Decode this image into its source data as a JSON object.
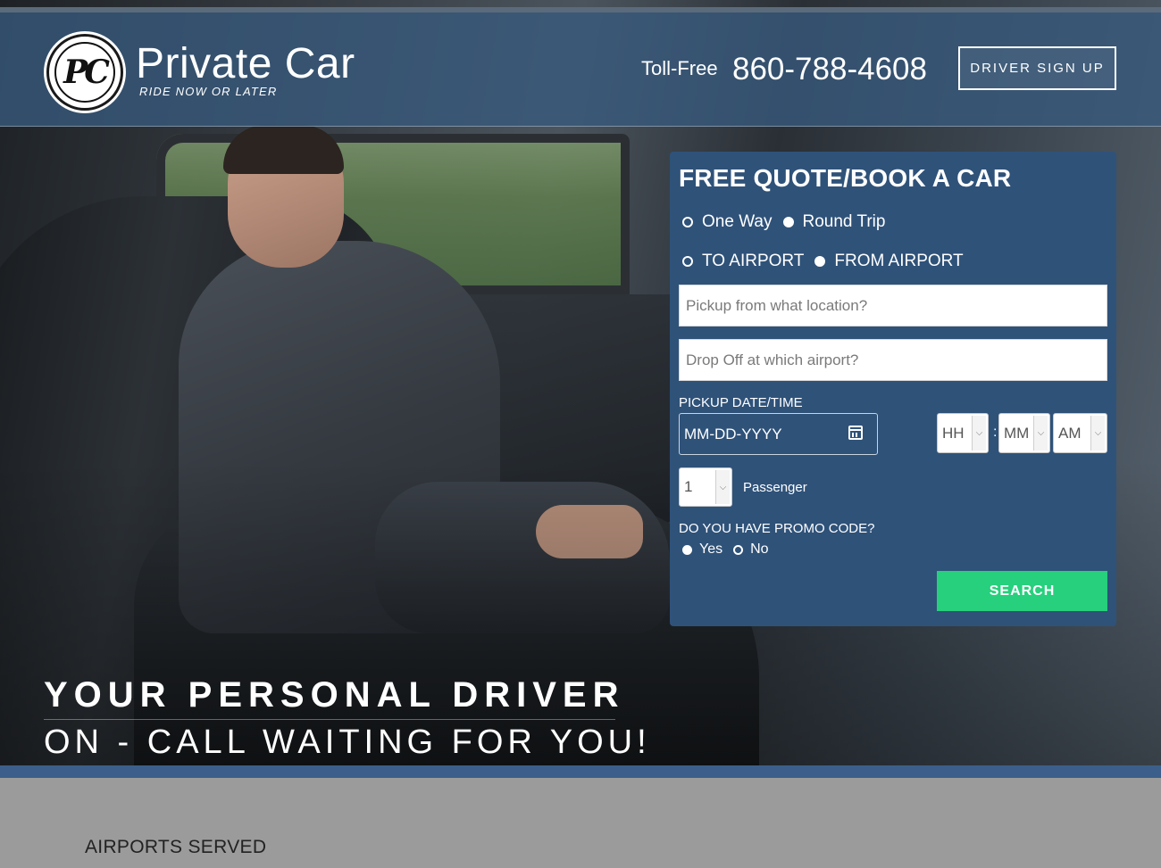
{
  "header": {
    "brand_name": "Private Car",
    "brand_tagline": "RIDE NOW OR LATER",
    "logo_mark": "PC",
    "phone_label": "Toll-Free",
    "phone_number": "860-788-4608",
    "driver_signup": "DRIVER SIGN UP"
  },
  "booking": {
    "title": "FREE QUOTE/BOOK A CAR",
    "trip_type": {
      "options": [
        "One Way",
        "Round Trip"
      ],
      "selected": "Round Trip"
    },
    "direction": {
      "options": [
        "TO AIRPORT",
        "FROM AIRPORT"
      ],
      "selected": "FROM AIRPORT"
    },
    "pickup_placeholder": "Pickup from what location?",
    "dropoff_placeholder": "Drop Off at which airport?",
    "datetime_label": "PICKUP DATE/TIME",
    "date_placeholder": "MM-DD-YYYY",
    "hour": "HH",
    "minute": "MM",
    "ampm": "AM",
    "passengers": "1",
    "passenger_label": "Passenger",
    "promo_question": "DO YOU HAVE PROMO CODE?",
    "promo": {
      "options": [
        "Yes",
        "No"
      ],
      "selected": "Yes"
    },
    "search_label": "SEARCH"
  },
  "hero": {
    "tagline_1": "YOUR PERSONAL DRIVER",
    "tagline_2": "ON - CALL WAITING FOR YOU!"
  },
  "sections": {
    "airports_heading": "AIRPORTS SERVED"
  },
  "colors": {
    "header_bg": "#375a7d",
    "panel_bg": "#2f5279",
    "search_button": "#26d07c",
    "band": "#3b5f8a"
  },
  "icons": [
    "calendar-icon",
    "chevron-down-icon"
  ]
}
